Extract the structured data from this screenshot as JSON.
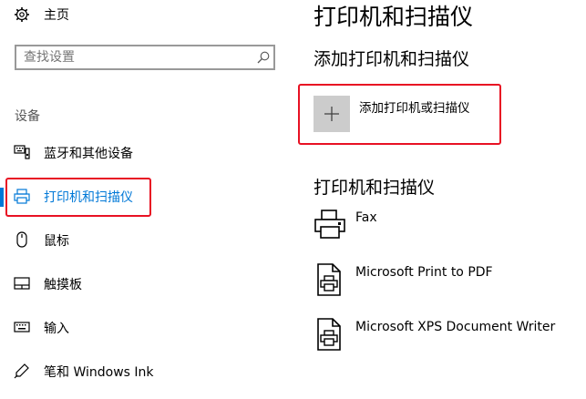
{
  "sidebar": {
    "home_label": "主页",
    "search": {
      "placeholder": "查找设置"
    },
    "section_title": "设备",
    "items": [
      {
        "label": "蓝牙和其他设备"
      },
      {
        "label": "打印机和扫描仪",
        "selected": true
      },
      {
        "label": "鼠标"
      },
      {
        "label": "触摸板"
      },
      {
        "label": "输入"
      },
      {
        "label": "笔和 Windows Ink"
      }
    ]
  },
  "main": {
    "page_title": "打印机和扫描仪",
    "add_section_title": "添加打印机和扫描仪",
    "add_button_label": "添加打印机或扫描仪",
    "list_section_title": "打印机和扫描仪",
    "printers": [
      {
        "name": "Fax"
      },
      {
        "name": "Microsoft Print to PDF"
      },
      {
        "name": "Microsoft XPS Document Writer"
      }
    ]
  },
  "colors": {
    "accent": "#0078d7",
    "highlight_border": "#e81123",
    "add_tile_bg": "#cccccc",
    "text": "#000000",
    "muted_text": "#555555"
  }
}
